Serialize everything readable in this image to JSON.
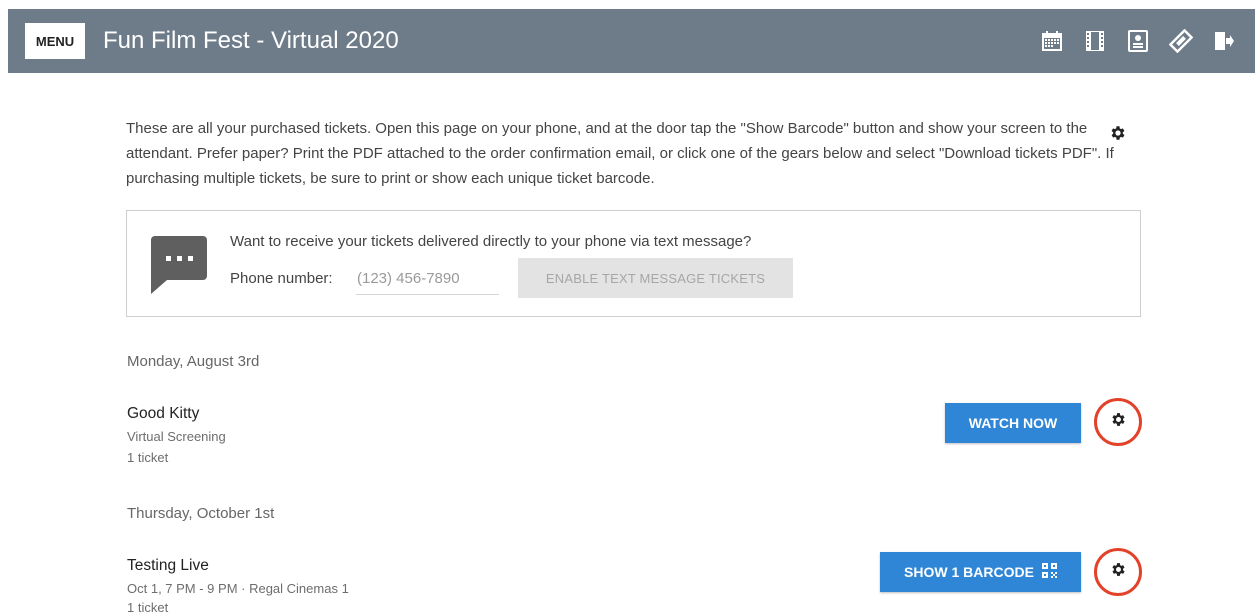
{
  "header": {
    "menu_label": "MENU",
    "title": "Fun Film Fest - Virtual 2020",
    "icons": [
      "calendar-icon",
      "film-icon",
      "contact-card-icon",
      "ticket-icon",
      "logout-icon"
    ],
    "bar_color": "#6e7c8a"
  },
  "intro": {
    "text": "These are all your purchased tickets. Open this page on your phone, and at the door tap the \"Show Barcode\" button and show your screen to the attendant. Prefer paper? Print the PDF attached to the order confirmation email, or click one of the gears below and select \"Download tickets PDF\". If purchasing multiple tickets, be sure to print or show each unique ticket barcode."
  },
  "sms": {
    "prompt": "Want to receive your tickets delivered directly to your phone via text message?",
    "phone_label": "Phone number:",
    "phone_placeholder": "(123) 456-7890",
    "enable_button": "ENABLE TEXT MESSAGE TICKETS"
  },
  "sections": [
    {
      "date": "Monday, August 3rd",
      "event": {
        "title": "Good Kitty",
        "details": "Virtual Screening",
        "tickets": "1 ticket",
        "action_label": "WATCH NOW"
      }
    },
    {
      "date": "Thursday, October 1st",
      "event": {
        "title": "Testing Live",
        "details": "Oct 1, 7 PM - 9 PM · Regal Cinemas 1",
        "tickets": "1 ticket",
        "action_label": "SHOW 1 BARCODE"
      }
    }
  ],
  "colors": {
    "accent": "#2f86d6",
    "highlight_ring": "#e3422a"
  }
}
